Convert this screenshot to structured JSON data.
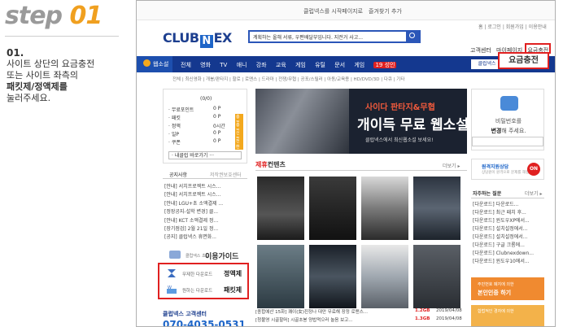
{
  "tutorial": {
    "step_word": "step",
    "step_num": "01",
    "index": "01.",
    "line1": "사이트 상단의 요금충전",
    "line2": "또는 사이트 좌측의",
    "line3": "패킷제/정액제를",
    "line4": "눌러주세요."
  },
  "site": {
    "top_links": {
      "start_page": "클럽넥스를 시작페이지로",
      "favorite": "즐겨찾기 추가"
    },
    "util_links": "홈 | 로그인 | 회원가입 | 이용안내",
    "logo_left": "CLUB",
    "logo_mark": "N",
    "logo_right": "EX",
    "search_placeholder": "계획하는 올해 서류, 우편배달부입니다. 지전거 사고...",
    "header_links": [
      "고객센터",
      "마이페이지",
      "요금충전"
    ],
    "callout_label": "요금충전",
    "gnb": {
      "home": "웹소설",
      "items": [
        "전체",
        "영화",
        "TV",
        "애니",
        "강좌",
        "교육",
        "게임",
        "유틸",
        "문서",
        "게임",
        "19 성인"
      ],
      "download": "클럽넥스 전용"
    },
    "subnav": "전체 | 최신영화 | 개봉/판타지 | 할로 | 로맨스 | 드라마 | 전쟁/무협 | 공포/스릴러 | 아동/교육용 | HD/DVD/3D | 다큐 | 기타",
    "points": {
      "header": "(0/0)",
      "rows": [
        {
          "label": "· 무료포인트",
          "value": "0 P",
          "tag": ""
        },
        {
          "label": "· 패킷",
          "value": "0 P",
          "tag": "충전"
        },
        {
          "label": "· 정액",
          "value": "0시간",
          "tag": "충전"
        },
        {
          "label": "· 일P",
          "value": "0 P",
          "tag": "신청"
        },
        {
          "label": "· 쿠폰",
          "value": "0 P",
          "tag": "전환"
        }
      ],
      "select": "· 내클럽 바로가기 ···"
    },
    "notice_tabs": {
      "on": "공지사항",
      "off": "저작권보호센터"
    },
    "notices": [
      "[안내] 서치프로젝트 시스...",
      "[안내] 서치프로젝트 시스...",
      "[안내] LGU+초 소액결제 ...",
      "[정장공지-설학 변경] 클...",
      "[안내] KCT 소액결제 정...",
      "[장기점검] 2월 21일 정...",
      "[공지] 클럽넥스 휴면화..."
    ],
    "guide": {
      "small": "클럽넥스 초보",
      "big": "이용가이드"
    },
    "plans": [
      {
        "small": "무제한 다운로드",
        "big": "정액제"
      },
      {
        "small": "원하는 다운로드",
        "big": "패킷제"
      }
    ],
    "cs_title": "클럽넥스 고객센터",
    "cs_phone": "070-4035-0531",
    "banner": {
      "t1": "사이다 판타지&무협",
      "t2": "개이득 무료 웹소설",
      "t3": "클럽넥스에서 최신웹소설 보세요!"
    },
    "content": {
      "title_red": "제휴",
      "title_rest": "컨텐츠",
      "more": "더보기 ▸"
    },
    "list_rows": [
      {
        "title": "[종합예산 15화] 쾌이(女)진정나 대만 무료해 장정 로맨스...",
        "size": "1.2GB",
        "date": "2019/04/08"
      },
      {
        "title": "[청불영 시골할머] 시골초봉 양밥먹으러 놀음 보고...",
        "size": "1.3GB",
        "date": "2019/04/08"
      }
    ],
    "password": {
      "t1": "비밀번호를",
      "t2_bold": "변경",
      "t2_rest": "해 주세요."
    },
    "remote": {
      "title": "원격지원상담",
      "small": "상담원이 원격으로 문제를 해결",
      "on": "ON"
    },
    "faq": {
      "title": "자주하는 질문",
      "more": "더보기 ▸",
      "items": [
        "[다운로드] 다운로드...",
        "[다운로드] 최근 패치 후...",
        "[다운로드] 윈도우XP에서...",
        "[다운로드] 설치설정에서...",
        "[다운로드] 설치설정에서...",
        "[다운로드] 구글 크롬에...",
        "[다운로드] Clubnexdown...",
        "[다운로드] 윈도우10에서..."
      ]
    },
    "verify": {
      "small": "주민번호 폐지에 의한",
      "big": "본인인증 하기"
    },
    "verify2": {
      "small": "합법적인 경자에 의한"
    }
  }
}
